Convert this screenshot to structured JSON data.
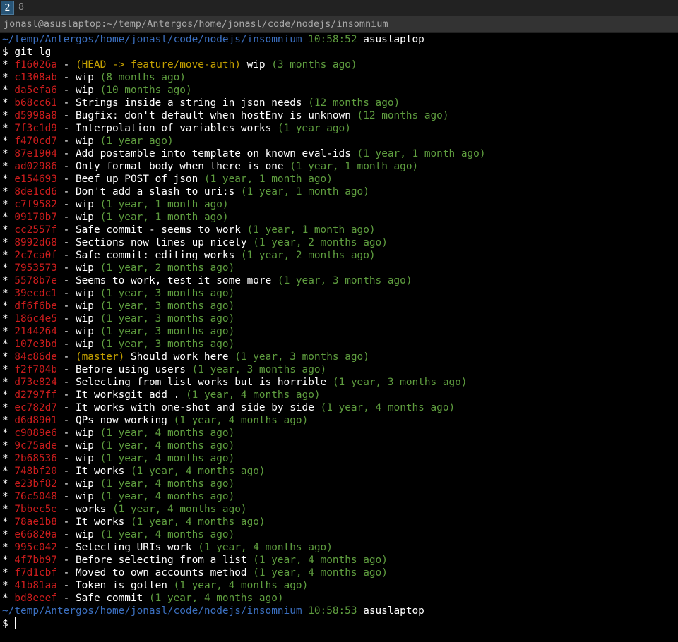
{
  "workspaces": [
    {
      "label": "2",
      "active": true
    },
    {
      "label": "8",
      "active": false
    }
  ],
  "window_title": "jonasl@asuslaptop:~/temp/Antergos/home/jonasl/code/nodejs/insomnium",
  "prompt_top": {
    "path": "~/temp/Antergos/home/jonasl/code/nodejs/insomnium",
    "time": "10:58:52",
    "host": "asuslaptop"
  },
  "command": "$ git lg",
  "commits": [
    {
      "hash": "f16026a",
      "refs": "(HEAD -> feature/move-auth)",
      "msg": "wip",
      "date": "(3 months ago)"
    },
    {
      "hash": "c1308ab",
      "refs": "",
      "msg": "wip",
      "date": "(8 months ago)"
    },
    {
      "hash": "da5efa6",
      "refs": "",
      "msg": "wip",
      "date": "(10 months ago)"
    },
    {
      "hash": "b68cc61",
      "refs": "",
      "msg": "Strings inside a string in json needs",
      "date": "(12 months ago)"
    },
    {
      "hash": "d5998a8",
      "refs": "",
      "msg": "Bugfix: don't default when hostEnv is unknown",
      "date": "(12 months ago)"
    },
    {
      "hash": "7f3c1d9",
      "refs": "",
      "msg": "Interpolation of variables works",
      "date": "(1 year ago)"
    },
    {
      "hash": "f470cd7",
      "refs": "",
      "msg": "wip",
      "date": "(1 year ago)"
    },
    {
      "hash": "87e1904",
      "refs": "",
      "msg": "Add postamble into template on known eval-ids",
      "date": "(1 year, 1 month ago)"
    },
    {
      "hash": "ad02986",
      "refs": "",
      "msg": "Only format body when there is one",
      "date": "(1 year, 1 month ago)"
    },
    {
      "hash": "e154693",
      "refs": "",
      "msg": "Beef up POST of json",
      "date": "(1 year, 1 month ago)"
    },
    {
      "hash": "8de1cd6",
      "refs": "",
      "msg": "Don't add a slash to uri:s",
      "date": "(1 year, 1 month ago)"
    },
    {
      "hash": "c7f9582",
      "refs": "",
      "msg": "wip",
      "date": "(1 year, 1 month ago)"
    },
    {
      "hash": "09170b7",
      "refs": "",
      "msg": "wip",
      "date": "(1 year, 1 month ago)"
    },
    {
      "hash": "cc2557f",
      "refs": "",
      "msg": "Safe commit - seems to work",
      "date": "(1 year, 1 month ago)"
    },
    {
      "hash": "8992d68",
      "refs": "",
      "msg": "Sections now lines up nicely",
      "date": "(1 year, 2 months ago)"
    },
    {
      "hash": "2c7ca0f",
      "refs": "",
      "msg": "Safe commit: editing works",
      "date": "(1 year, 2 months ago)"
    },
    {
      "hash": "7953573",
      "refs": "",
      "msg": "wip",
      "date": "(1 year, 2 months ago)"
    },
    {
      "hash": "5578b7e",
      "refs": "",
      "msg": "Seems to work, test it some more",
      "date": "(1 year, 3 months ago)"
    },
    {
      "hash": "39ecdc1",
      "refs": "",
      "msg": "wip",
      "date": "(1 year, 3 months ago)"
    },
    {
      "hash": "df6f6be",
      "refs": "",
      "msg": "wip",
      "date": "(1 year, 3 months ago)"
    },
    {
      "hash": "186c4e5",
      "refs": "",
      "msg": "wip",
      "date": "(1 year, 3 months ago)"
    },
    {
      "hash": "2144264",
      "refs": "",
      "msg": "wip",
      "date": "(1 year, 3 months ago)"
    },
    {
      "hash": "107e3bd",
      "refs": "",
      "msg": "wip",
      "date": "(1 year, 3 months ago)"
    },
    {
      "hash": "84c86de",
      "refs": "(master)",
      "msg": "Should work here",
      "date": "(1 year, 3 months ago)"
    },
    {
      "hash": "f2f704b",
      "refs": "",
      "msg": "Before using users",
      "date": "(1 year, 3 months ago)"
    },
    {
      "hash": "d73e824",
      "refs": "",
      "msg": "Selecting from list works but is horrible",
      "date": "(1 year, 3 months ago)"
    },
    {
      "hash": "d2797ff",
      "refs": "",
      "msg": "It worksgit add .",
      "date": "(1 year, 4 months ago)"
    },
    {
      "hash": "ec782d7",
      "refs": "",
      "msg": "It works with one-shot and side by side",
      "date": "(1 year, 4 months ago)"
    },
    {
      "hash": "d6d8901",
      "refs": "",
      "msg": "QPs now working",
      "date": "(1 year, 4 months ago)"
    },
    {
      "hash": "c9089e6",
      "refs": "",
      "msg": "wip",
      "date": "(1 year, 4 months ago)"
    },
    {
      "hash": "9c75ade",
      "refs": "",
      "msg": "wip",
      "date": "(1 year, 4 months ago)"
    },
    {
      "hash": "2b68536",
      "refs": "",
      "msg": "wip",
      "date": "(1 year, 4 months ago)"
    },
    {
      "hash": "748bf20",
      "refs": "",
      "msg": "It works",
      "date": "(1 year, 4 months ago)"
    },
    {
      "hash": "e23bf82",
      "refs": "",
      "msg": "wip",
      "date": "(1 year, 4 months ago)"
    },
    {
      "hash": "76c5048",
      "refs": "",
      "msg": "wip",
      "date": "(1 year, 4 months ago)"
    },
    {
      "hash": "7bbec5e",
      "refs": "",
      "msg": "works",
      "date": "(1 year, 4 months ago)"
    },
    {
      "hash": "78ae1b8",
      "refs": "",
      "msg": "It works",
      "date": "(1 year, 4 months ago)"
    },
    {
      "hash": "e66820a",
      "refs": "",
      "msg": "wip",
      "date": "(1 year, 4 months ago)"
    },
    {
      "hash": "995c042",
      "refs": "",
      "msg": "Selecting URIs work",
      "date": "(1 year, 4 months ago)"
    },
    {
      "hash": "4f7bb97",
      "refs": "",
      "msg": "Before selecting from a list",
      "date": "(1 year, 4 months ago)"
    },
    {
      "hash": "f7d1cbf",
      "refs": "",
      "msg": "Moved to own accounts method",
      "date": "(1 year, 4 months ago)"
    },
    {
      "hash": "41b81aa",
      "refs": "",
      "msg": "Token is gotten",
      "date": "(1 year, 4 months ago)"
    },
    {
      "hash": "bd8eeef",
      "refs": "",
      "msg": "Safe commit",
      "date": "(1 year, 4 months ago)"
    }
  ],
  "prompt_bottom": {
    "path": "~/temp/Antergos/home/jonasl/code/nodejs/insomnium",
    "time": "10:58:53",
    "host": "asuslaptop"
  },
  "input_prompt": "$ "
}
